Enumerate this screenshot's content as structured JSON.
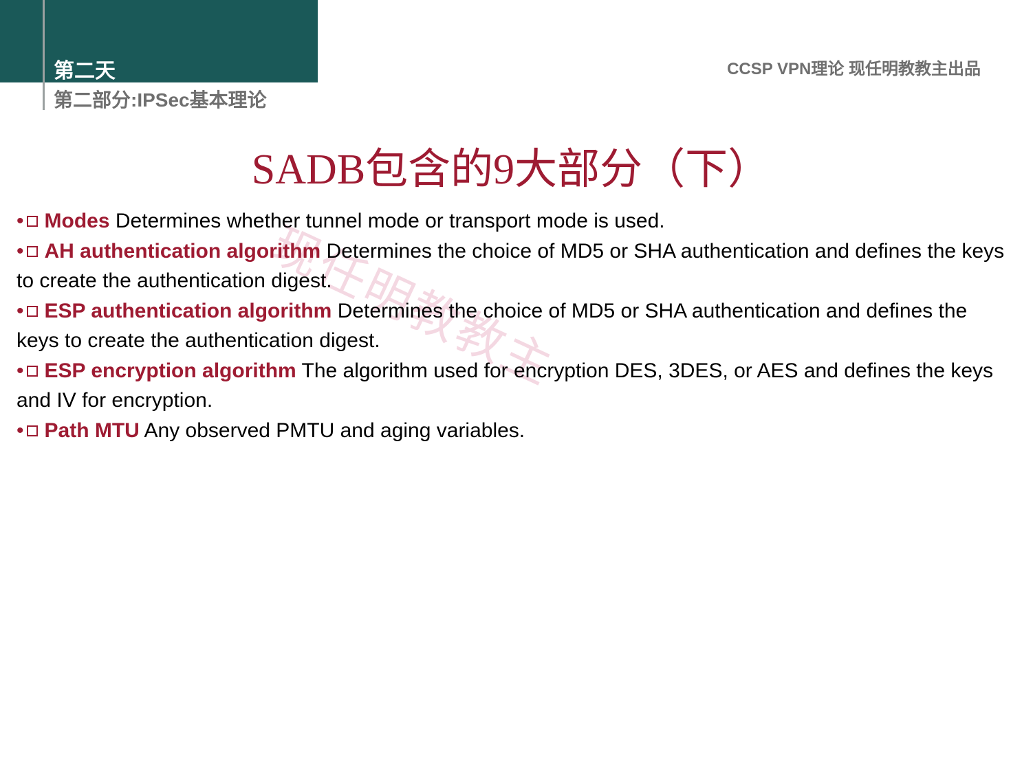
{
  "header": {
    "day": "第二天",
    "section": "第二部分:IPSec基本理论",
    "right": "CCSP VPN理论 现任明教教主出品"
  },
  "title": "SADB包含的9大部分（下）",
  "bullets": [
    {
      "term": "Modes",
      "desc": " Determines whether tunnel mode or transport mode is used."
    },
    {
      "term": "AH authentication algorithm",
      "desc": " Determines the choice of MD5 or SHA authentication and defines the keys to create the authentication digest."
    },
    {
      "term": "ESP authentication algorithm",
      "desc": " Determines the choice of MD5 or SHA authentication and defines the keys to create the authentication digest."
    },
    {
      "term": "ESP encryption algorithm",
      "desc": " The algorithm used for encryption DES, 3DES, or AES and defines the keys and IV for encryption."
    },
    {
      "term": "Path MTU",
      "desc": " Any observed PMTU and aging variables."
    }
  ],
  "watermark": "现任明教教主"
}
